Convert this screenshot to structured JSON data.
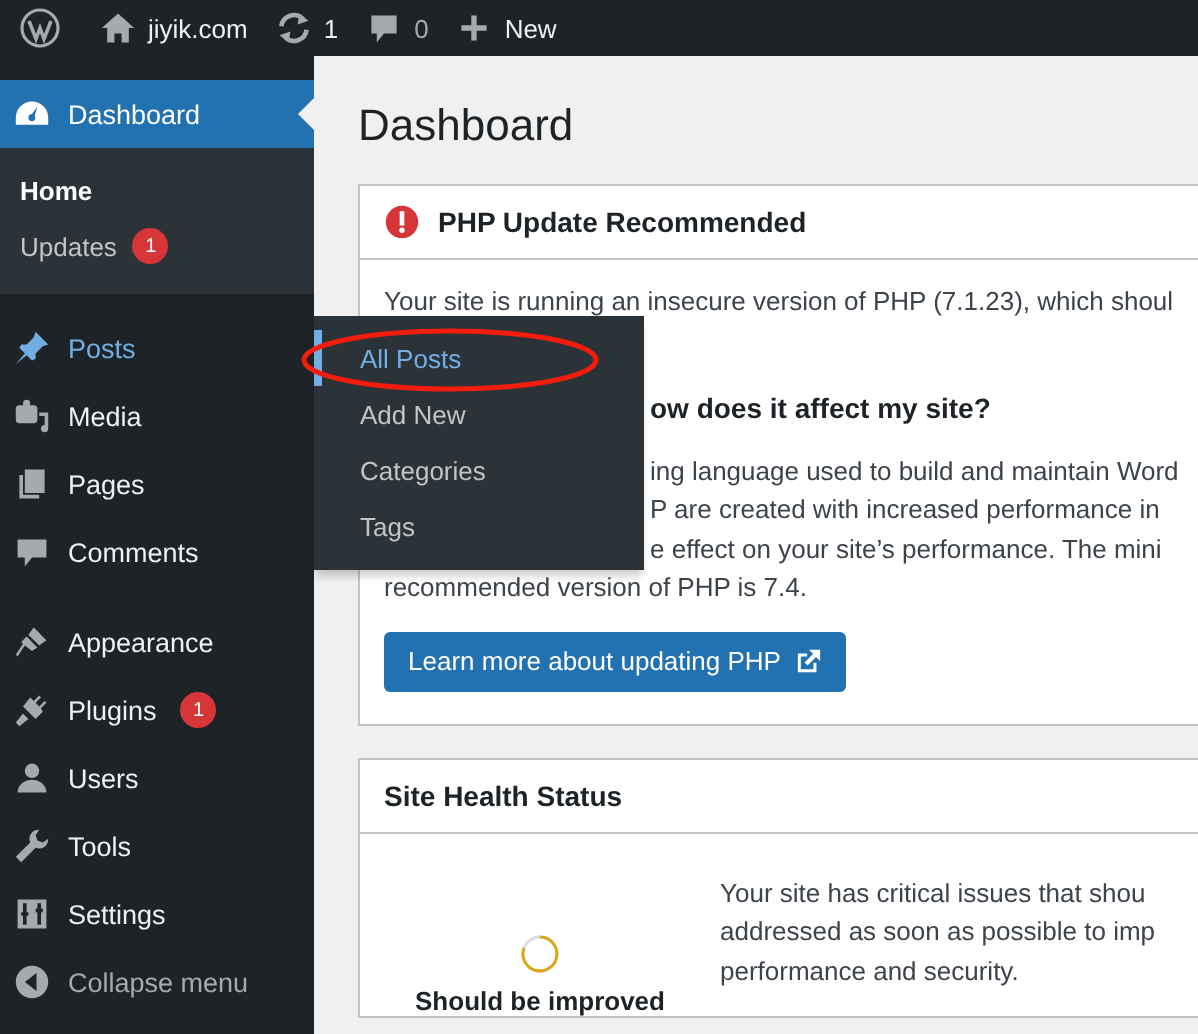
{
  "top_bar": {
    "site_name": "jiyik.com",
    "updates_count": "1",
    "comments_count": "0",
    "new_label": "New"
  },
  "sidebar": {
    "items": [
      {
        "kind": "dashboard",
        "label": "Dashboard",
        "selected": true,
        "highlighted": false,
        "children": [
          {
            "label": "Home",
            "selected": true
          },
          {
            "label": "Updates",
            "selected": false,
            "badge": "1"
          }
        ]
      },
      {
        "kind": "posts",
        "label": "Posts",
        "selected": false,
        "highlighted": true
      },
      {
        "kind": "media",
        "label": "Media",
        "selected": false,
        "highlighted": false
      },
      {
        "kind": "pages",
        "label": "Pages",
        "selected": false,
        "highlighted": false
      },
      {
        "kind": "comments",
        "label": "Comments",
        "selected": false,
        "highlighted": false
      },
      {
        "kind": "appearance",
        "label": "Appearance",
        "selected": false,
        "highlighted": false
      },
      {
        "kind": "plugins",
        "label": "Plugins",
        "selected": false,
        "highlighted": false,
        "badge": "1"
      },
      {
        "kind": "users",
        "label": "Users",
        "selected": false,
        "highlighted": false
      },
      {
        "kind": "tools",
        "label": "Tools",
        "selected": false,
        "highlighted": false
      },
      {
        "kind": "settings",
        "label": "Settings",
        "selected": false,
        "highlighted": false
      }
    ],
    "collapse_label": "Collapse menu"
  },
  "flyout_menu": {
    "items": [
      {
        "label": "All Posts",
        "selected": true
      },
      {
        "label": "Add New",
        "selected": false
      },
      {
        "label": "Categories",
        "selected": false
      },
      {
        "label": "Tags",
        "selected": false
      }
    ]
  },
  "page_title": "Dashboard",
  "php_notice": {
    "title": "PHP Update Recommended",
    "intro": "Your site is running an insecure version of PHP (7.1.23), which shoul",
    "subheading": "ow does it affect my site?",
    "covered_lines": [
      "ing language used to build and maintain Word",
      "P are created with increased performance in",
      "e effect on your site’s performance. The mini"
    ],
    "last_line": "recommended version of PHP is 7.4.",
    "button": "Learn more about updating PHP"
  },
  "site_health": {
    "title": "Site Health Status",
    "status": "Should be improved",
    "text": "Your site has critical issues that shou addressed as soon as possible to imp performance and security."
  }
}
